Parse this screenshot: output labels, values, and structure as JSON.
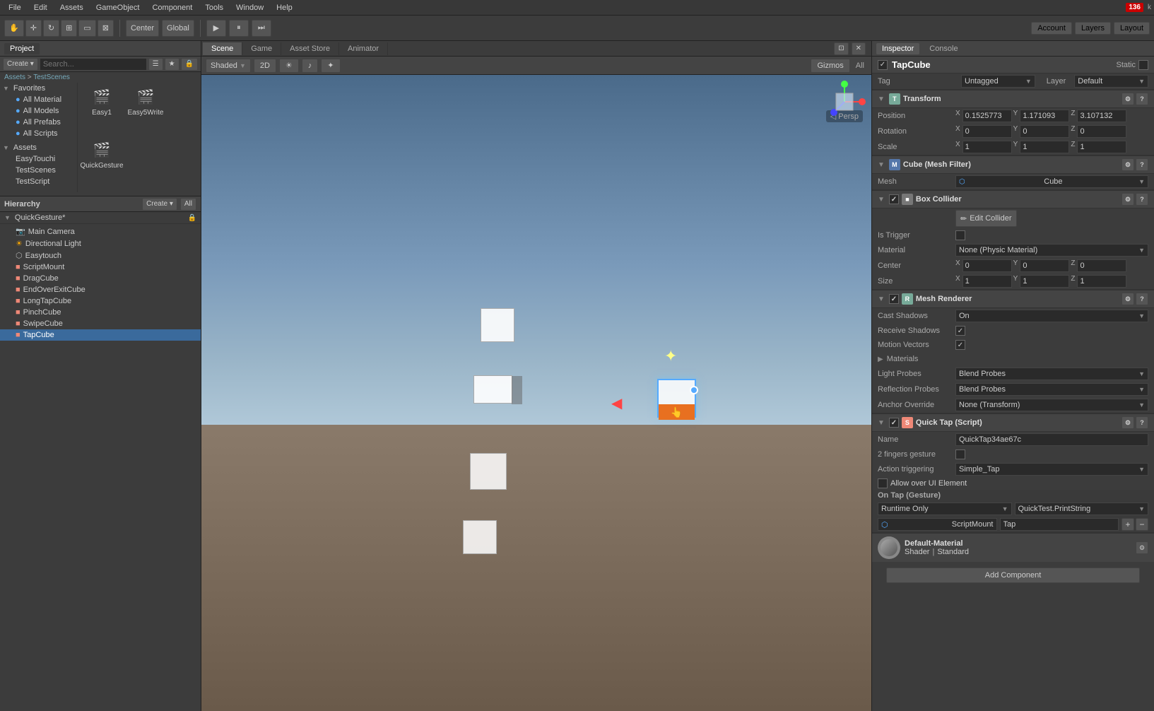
{
  "menubar": {
    "items": [
      "File",
      "Edit",
      "Assets",
      "GameObject",
      "Component",
      "Tools",
      "Window",
      "Help"
    ]
  },
  "toolbar": {
    "center_label": "Center",
    "global_label": "Global",
    "play_title": "Play",
    "pause_title": "Pause",
    "step_title": "Step",
    "account_label": "Account",
    "layers_label": "Layers",
    "layout_label": "Layout",
    "fps": "136"
  },
  "scene_tabs": [
    {
      "label": "Scene",
      "active": true
    },
    {
      "label": "Game",
      "active": false
    },
    {
      "label": "Asset Store",
      "active": false
    },
    {
      "label": "Animator",
      "active": false
    }
  ],
  "scene_toolbar": {
    "shaded_label": "Shaded",
    "twod_label": "2D",
    "gizmos_label": "Gizmos",
    "all_label": "All"
  },
  "project_panel": {
    "title": "Project",
    "create_label": "Create ▾",
    "breadcrumb": [
      "Assets",
      "TestScenes"
    ],
    "favorites": {
      "title": "Favorites",
      "items": [
        "All Material",
        "All Models",
        "All Prefabs",
        "All Scripts"
      ]
    },
    "assets": {
      "title": "Assets",
      "items": [
        "EasyTouchi",
        "TestScenes",
        "TestScript"
      ]
    },
    "test_scenes": {
      "items": [
        "Easy1",
        "Easy5Write",
        "QuickGesture"
      ]
    }
  },
  "hierarchy_panel": {
    "title": "Hierarchy",
    "create_label": "Create ▾",
    "all_label": "All",
    "scene_name": "QuickGesture*",
    "objects": [
      {
        "name": "Main Camera",
        "icon": "grey",
        "indent": 1
      },
      {
        "name": "Directional Light",
        "icon": "orange",
        "indent": 1
      },
      {
        "name": "Easytouch",
        "icon": "grey",
        "indent": 1
      },
      {
        "name": "ScriptMount",
        "icon": "orange",
        "indent": 1
      },
      {
        "name": "DragCube",
        "icon": "orange",
        "indent": 1
      },
      {
        "name": "EndOverExitCube",
        "icon": "orange",
        "indent": 1
      },
      {
        "name": "LongTapCube",
        "icon": "orange",
        "indent": 1
      },
      {
        "name": "PinchCube",
        "icon": "orange",
        "indent": 1
      },
      {
        "name": "SwipeCube",
        "icon": "orange",
        "indent": 1
      },
      {
        "name": "TapCube",
        "icon": "orange",
        "indent": 1,
        "selected": true
      }
    ]
  },
  "inspector": {
    "tab_inspector": "Inspector",
    "tab_console": "Console",
    "game_object_name": "TapCube",
    "tag_label": "Tag",
    "tag_value": "Untagged",
    "layer_label": "Layer",
    "layer_value": "Default",
    "static_label": "Static",
    "component_label": "Cube",
    "transform": {
      "title": "Transform",
      "position_label": "Position",
      "px": "0.1525773",
      "py": "1.171093",
      "pz": "3.107132",
      "rotation_label": "Rotation",
      "rx": "0",
      "ry": "0",
      "rz": "0",
      "scale_label": "Scale",
      "sx": "1",
      "sy": "1",
      "sz": "1"
    },
    "mesh_filter": {
      "title": "Cube (Mesh Filter)",
      "mesh_label": "Mesh",
      "mesh_value": "Cube"
    },
    "box_collider": {
      "title": "Box Collider",
      "edit_btn": "Edit Collider",
      "is_trigger_label": "Is Trigger",
      "material_label": "Material",
      "material_value": "None (Physic Material)",
      "center_label": "Center",
      "cx": "0",
      "cy": "0",
      "cz": "0",
      "size_label": "Size",
      "sx": "1",
      "sy": "1",
      "sz": "1"
    },
    "mesh_renderer": {
      "title": "Mesh Renderer",
      "cast_shadows_label": "Cast Shadows",
      "cast_shadows_value": "On",
      "receive_shadows_label": "Receive Shadows",
      "motion_vectors_label": "Motion Vectors",
      "materials_label": "Materials",
      "light_probes_label": "Light Probes",
      "light_probes_value": "Blend Probes",
      "reflection_probes_label": "Reflection Probes",
      "reflection_probes_value": "Blend Probes",
      "anchor_override_label": "Anchor Override",
      "anchor_override_value": "None (Transform)"
    },
    "quick_tap": {
      "title": "Quick Tap (Script)",
      "name_label": "Name",
      "name_value": "QuickTap34ae67c",
      "two_fingers_label": "2 fingers gesture",
      "action_trigger_label": "Action triggering",
      "action_trigger_value": "Simple_Tap",
      "allow_ui_label": "Allow over UI Element",
      "on_tap_label": "On Tap (Gesture)",
      "runtime_only": "Runtime Only",
      "script_mount": "ScriptMount",
      "tap_function": "Tap",
      "function_name": "QuickTest.PrintString"
    },
    "material": {
      "name": "Default-Material",
      "shader_label": "Shader",
      "shader_value": "Standard"
    },
    "add_component_label": "Add Component"
  }
}
